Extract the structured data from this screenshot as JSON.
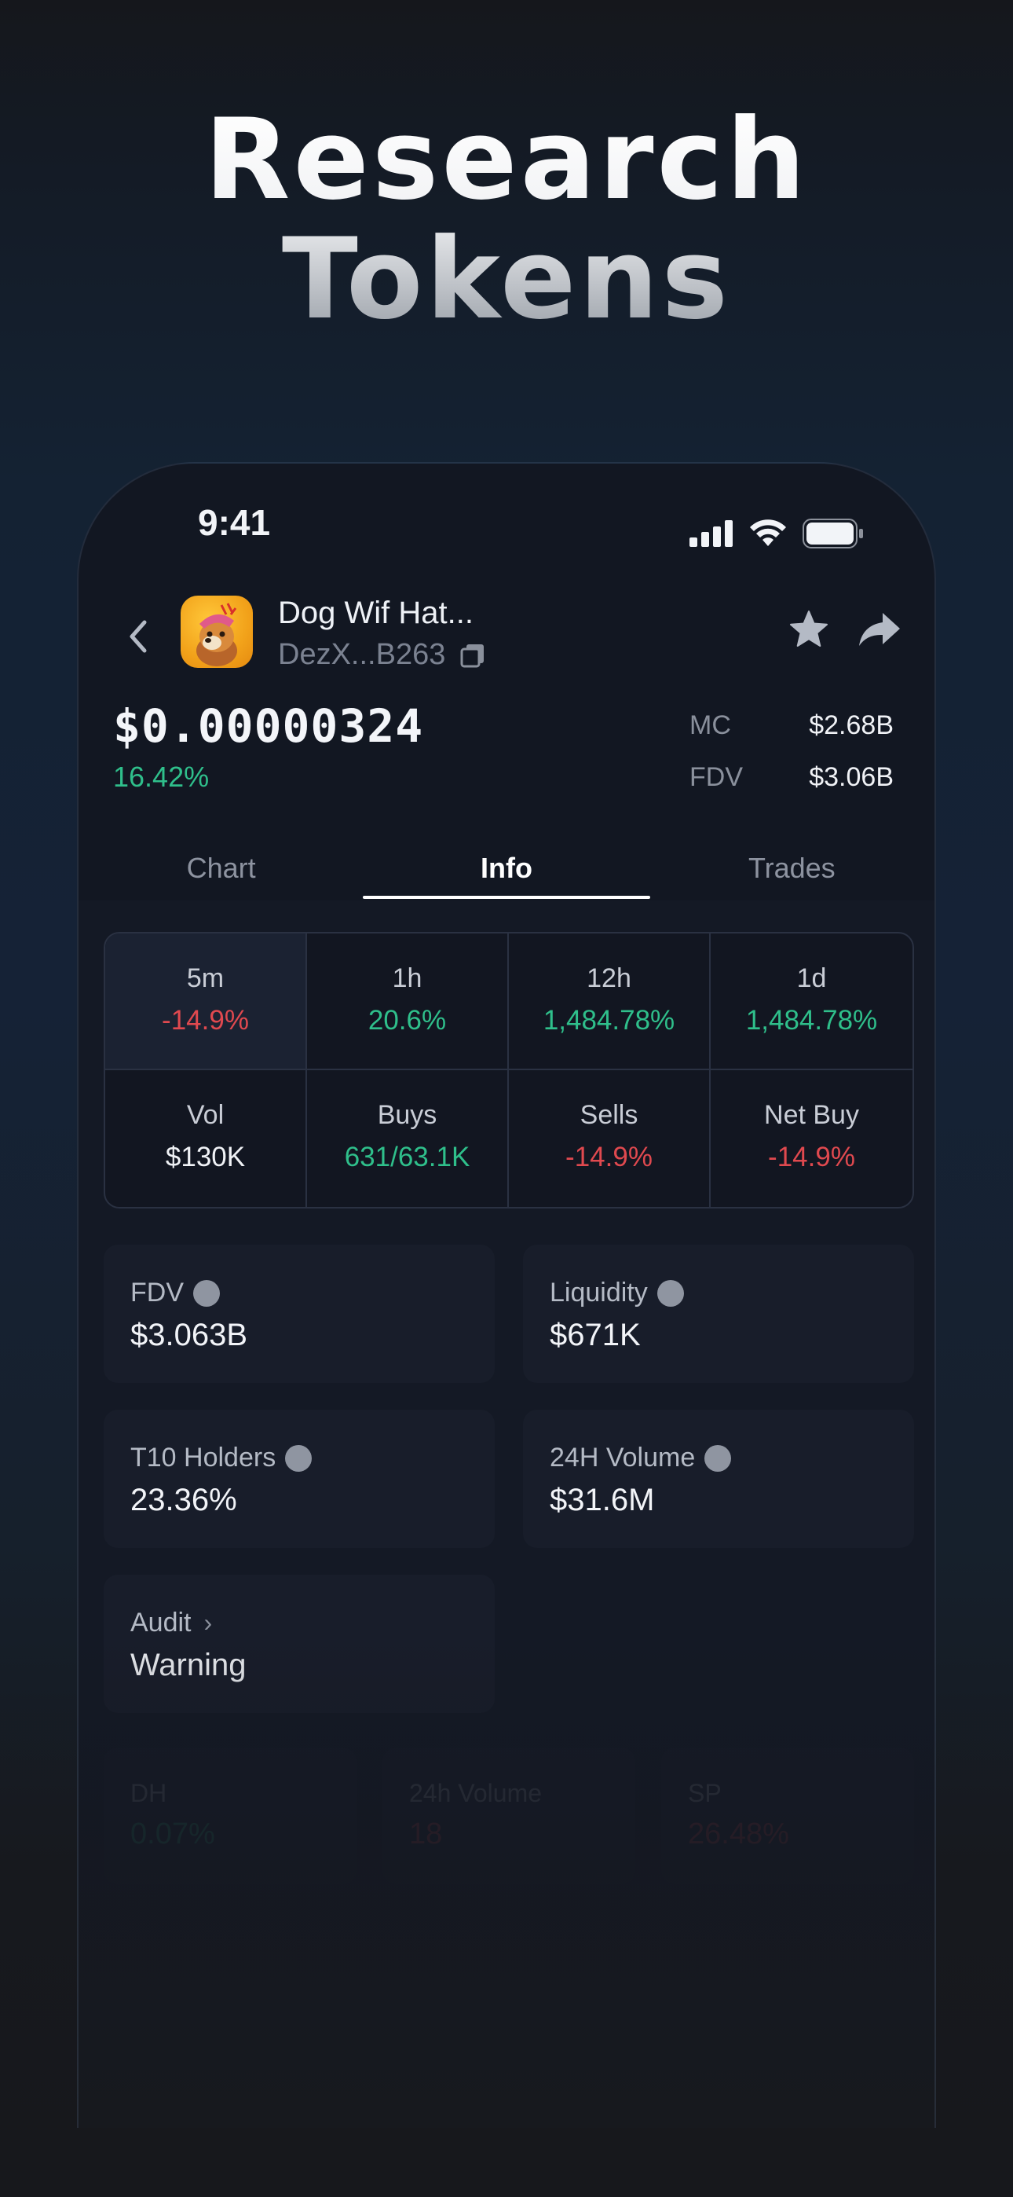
{
  "headline": {
    "line1": "Research",
    "line2": "Tokens"
  },
  "status": {
    "time": "9:41"
  },
  "token": {
    "name": "Dog Wif Hat...",
    "address": "DezX...B263",
    "price": "$0.00000324",
    "change": "16.42%",
    "mc_label": "MC",
    "mc_value": "$2.68B",
    "fdv_label": "FDV",
    "fdv_value": "$3.06B"
  },
  "tabs": [
    {
      "label": "Chart",
      "active": false
    },
    {
      "label": "Info",
      "active": true
    },
    {
      "label": "Trades",
      "active": false
    }
  ],
  "stats": [
    {
      "label": "5m",
      "value": "-14.9%",
      "tone": "red",
      "selected": true
    },
    {
      "label": "1h",
      "value": "20.6%",
      "tone": "green"
    },
    {
      "label": "12h",
      "value": "1,484.78%",
      "tone": "green"
    },
    {
      "label": "1d",
      "value": "1,484.78%",
      "tone": "green"
    },
    {
      "label": "Vol",
      "value": "$130K",
      "tone": "white"
    },
    {
      "label": "Buys",
      "value": "631/63.1K",
      "tone": "green"
    },
    {
      "label": "Sells",
      "value": "-14.9%",
      "tone": "red"
    },
    {
      "label": "Net Buy",
      "value": "-14.9%",
      "tone": "red"
    }
  ],
  "cards": {
    "fdv": {
      "label": "FDV",
      "value": "$3.063B"
    },
    "liquidity": {
      "label": "Liquidity",
      "value": "$671K"
    },
    "holders": {
      "label": "T10 Holders",
      "value": "23.36%"
    },
    "volume": {
      "label": "24H Volume",
      "value": "$31.6M"
    },
    "audit": {
      "label": "Audit",
      "chevron": "›",
      "value": "Warning"
    }
  },
  "faded": [
    {
      "label": "DH",
      "value": "0.07%",
      "tone": "green"
    },
    {
      "label": "24h Volume",
      "value": "18",
      "tone": "red"
    },
    {
      "label": "SP",
      "value": "26.48%",
      "tone": "red"
    }
  ],
  "colors": {
    "positive": "#2fbf8b",
    "negative": "#e0494f",
    "warning": "#c39a1c"
  }
}
